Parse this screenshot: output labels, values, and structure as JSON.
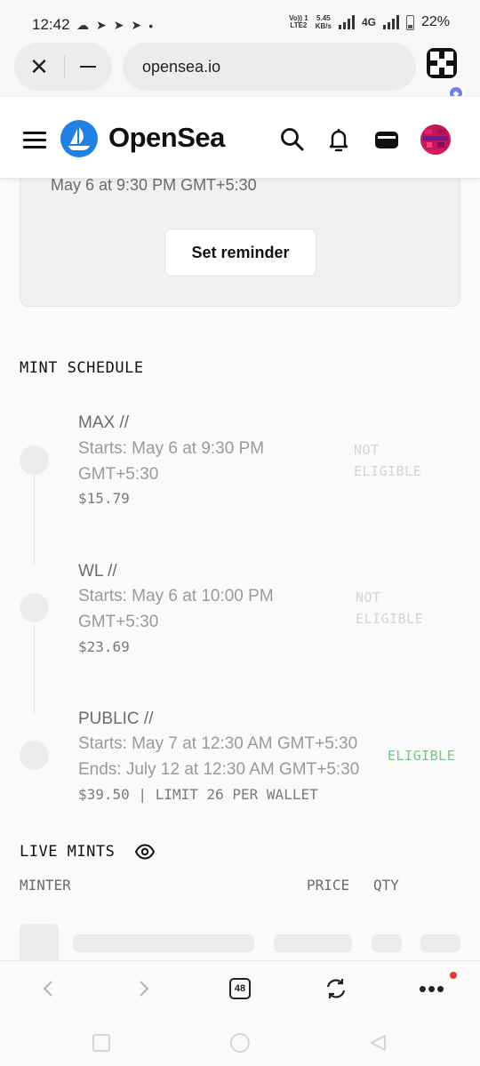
{
  "status_bar": {
    "time": "12:42",
    "volte_label": "Vo)) 1",
    "lte_label": "LTE2",
    "net_speed_value": "5.45",
    "net_speed_unit": "KB/s",
    "network_type": "4G",
    "battery": "22%"
  },
  "browser": {
    "url": "opensea.io"
  },
  "header": {
    "brand": "OpenSea"
  },
  "reminder": {
    "date_text": "May 6 at 9:30 PM GMT+5:30",
    "button_label": "Set reminder"
  },
  "mint_schedule": {
    "title": "MINT SCHEDULE",
    "phases": [
      {
        "name": "MAX //",
        "start_line1": "Starts: May 6 at 9:30 PM",
        "start_line2": "GMT+5:30",
        "price": "$15.79",
        "status_line1": "NOT",
        "status_line2": "ELIGIBLE"
      },
      {
        "name": "WL //",
        "start_line1": "Starts: May 6 at 10:00 PM",
        "start_line2": "GMT+5:30",
        "price": "$23.69",
        "status_line1": "NOT",
        "status_line2": "ELIGIBLE"
      },
      {
        "name": "PUBLIC //",
        "start_line1": "Starts: May 7 at 12:30 AM GMT+5:30",
        "start_line2": "Ends: July 12 at 12:30 AM GMT+5:30",
        "price": "$39.50 | LIMIT 26 PER WALLET",
        "status_line1": "ELIGIBLE",
        "status_line2": ""
      }
    ]
  },
  "live_mints": {
    "title": "LIVE MINTS",
    "columns": [
      "MINTER",
      "PRICE",
      "QTY"
    ]
  },
  "bottom_nav": {
    "tab_count": "48"
  },
  "colors": {
    "brand_blue": "#2081e2",
    "eligible_green": "#7bc28a",
    "ext_badge": "#6f7ff0",
    "notification_red": "#e53935"
  }
}
